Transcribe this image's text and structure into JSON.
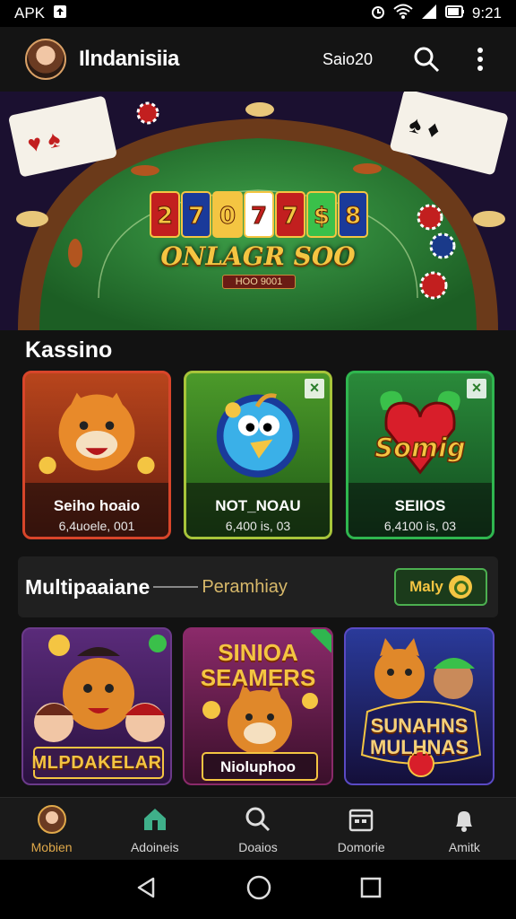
{
  "status_bar": {
    "left_text": "APK",
    "time": "9:21"
  },
  "app_bar": {
    "title": "Ilndanisiia",
    "balance": "Saio20"
  },
  "hero": {
    "title": "ONLAGR SOO",
    "subtitle": "HOO 9001",
    "reels": [
      "2",
      "7",
      "0",
      "7",
      "7",
      "$",
      "8"
    ]
  },
  "section_title": "Kassino",
  "games": [
    {
      "name": "Seiho hoaio",
      "meta": "6,4uoele, 001"
    },
    {
      "name": "NOT_NOAU",
      "meta": "6,400 is, 03"
    },
    {
      "name": "SEIIOS",
      "meta": "6,4100 is, 03",
      "art_text": "Somig"
    }
  ],
  "multi": {
    "title": "Multipaaiane",
    "subtitle": "Peramhiay",
    "button": "Maly"
  },
  "multi_games": [
    {
      "label": "MLPDAKELAR"
    },
    {
      "label_top": "SINIOA SEAMERS",
      "label": "Nioluphoo"
    },
    {
      "label": "SUNAHNS MULHNAS"
    }
  ],
  "bottom_nav": [
    {
      "label": "Mobien",
      "icon": "profile-icon"
    },
    {
      "label": "Adoineis",
      "icon": "home-icon"
    },
    {
      "label": "Doaios",
      "icon": "search-icon"
    },
    {
      "label": "Domorie",
      "icon": "calendar-icon"
    },
    {
      "label": "Amitk",
      "icon": "bell-icon"
    }
  ],
  "colors": {
    "accent": "#e0a94a",
    "green": "#4caf50",
    "gold": "#f4c542"
  }
}
